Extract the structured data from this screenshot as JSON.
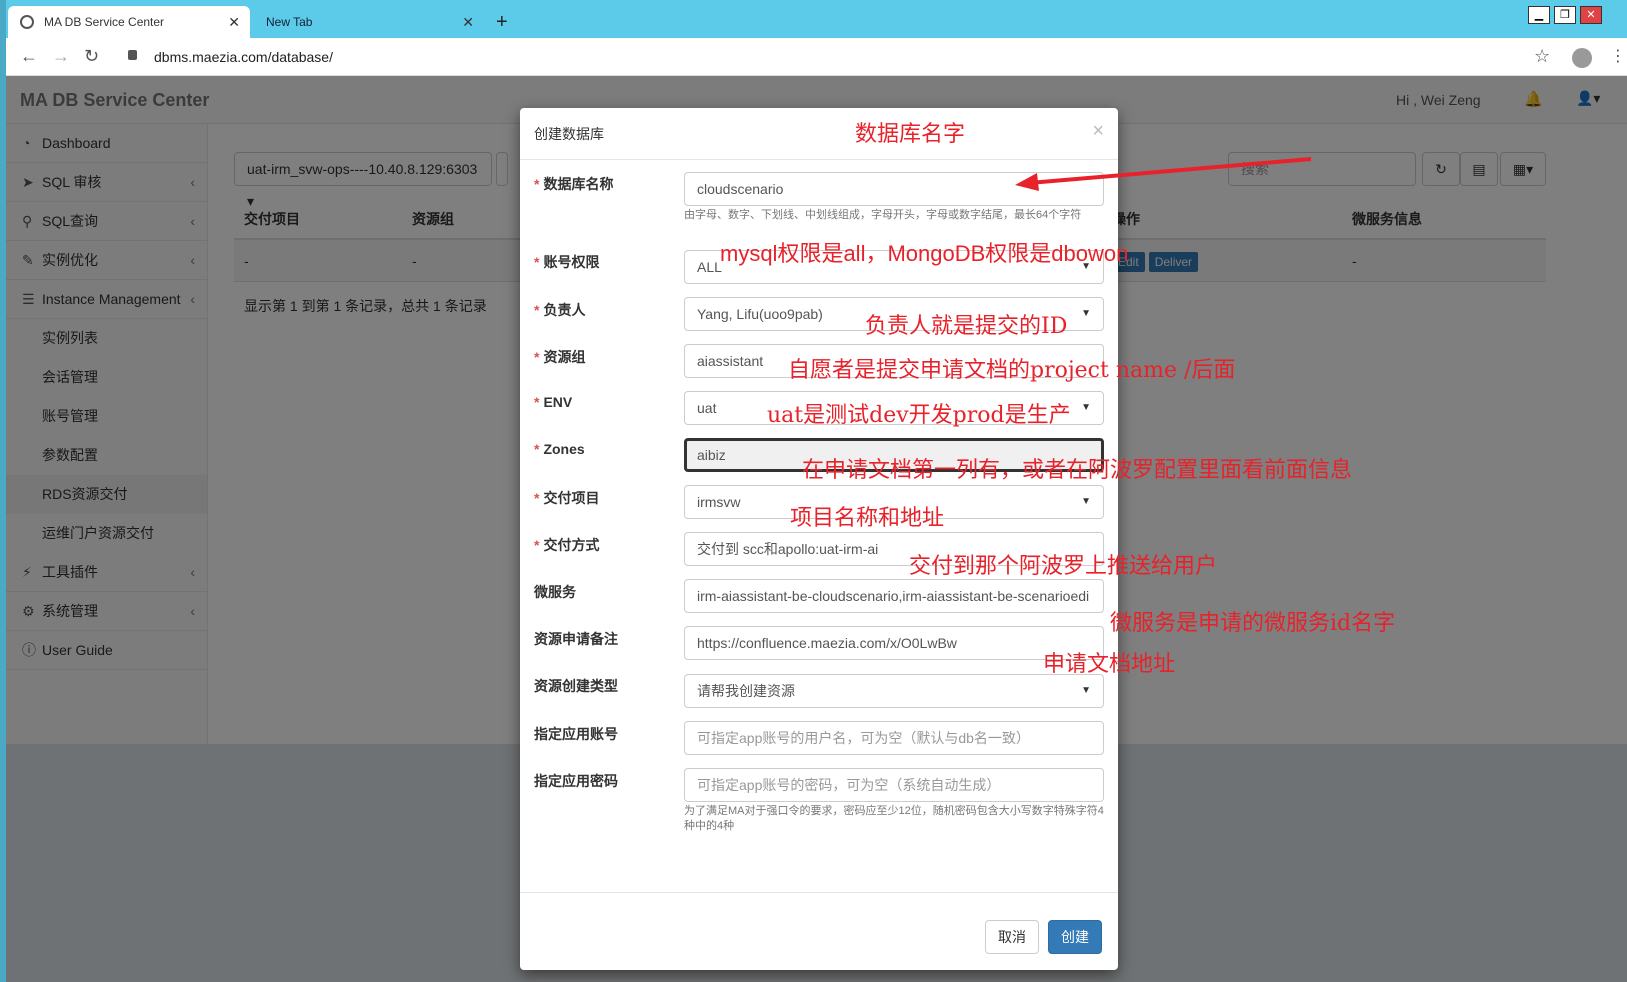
{
  "browser": {
    "tabs": [
      {
        "title": "MA DB Service Center",
        "active": true
      },
      {
        "title": "New Tab",
        "active": false
      }
    ],
    "new_tab_icon": "+",
    "url": "dbms.maezia.com/database/",
    "window_buttons": [
      "minimize",
      "restore",
      "close"
    ]
  },
  "header": {
    "brand": "MA DB Service Center",
    "greeting": "Hi , Wei Zeng"
  },
  "sidebar": {
    "items": [
      {
        "label": "Dashboard",
        "icon": "dashboard-icon"
      },
      {
        "label": "SQL 审核",
        "icon": "send-icon"
      },
      {
        "label": "SQL查询",
        "icon": "search-icon"
      },
      {
        "label": "实例优化",
        "icon": "wrench-icon"
      },
      {
        "label": "Instance Management",
        "icon": "database-icon"
      },
      {
        "label": "实例列表"
      },
      {
        "label": "会话管理"
      },
      {
        "label": "账号管理"
      },
      {
        "label": "参数配置"
      },
      {
        "label": "RDS资源交付"
      },
      {
        "label": "运维门户资源交付"
      },
      {
        "label": "工具插件",
        "icon": "plug-icon"
      },
      {
        "label": "系统管理",
        "icon": "gears-icon"
      },
      {
        "label": "User Guide",
        "icon": "info-icon"
      }
    ]
  },
  "content": {
    "instance_select": "uat-irm_svw-ops----10.40.8.129:6303",
    "search_placeholder": "搜索",
    "table": {
      "columns": [
        "交付项目",
        "资源组",
        "操作",
        "微服务信息"
      ],
      "row": [
        "-",
        "-",
        "",
        "-"
      ],
      "actions": [
        "Edit",
        "Deliver"
      ]
    },
    "summary": "显示第 1 到第 1 条记录，总共 1 条记录"
  },
  "modal": {
    "title": "创建数据库",
    "fields": [
      {
        "label": "数据库名称",
        "required": true,
        "value": "cloudscenario",
        "help": "由字母、数字、下划线、中划线组成，字母开头，字母或数字结尾，最长64个字符"
      },
      {
        "label": "账号权限",
        "required": true,
        "value": "ALL"
      },
      {
        "label": "负责人",
        "required": true,
        "value": "Yang, Lifu(uoo9pab)"
      },
      {
        "label": "资源组",
        "required": true,
        "value": "aiassistant"
      },
      {
        "label": "ENV",
        "required": true,
        "value": "uat"
      },
      {
        "label": "Zones",
        "required": true,
        "value": "aibiz"
      },
      {
        "label": "交付项目",
        "required": true,
        "value": "irmsvw"
      },
      {
        "label": "交付方式",
        "required": true,
        "value": "交付到 scc和apollo:uat-irm-ai"
      },
      {
        "label": "微服务",
        "required": false,
        "value": "irm-aiassistant-be-cloudscenario,irm-aiassistant-be-scenarioedi"
      },
      {
        "label": "资源申请备注",
        "required": false,
        "value": "https://confluence.maezia.com/x/O0LwBw"
      },
      {
        "label": "资源创建类型",
        "required": false,
        "value": "请帮我创建资源"
      },
      {
        "label": "指定应用账号",
        "required": false,
        "placeholder": "可指定app账号的用户名，可为空（默认与db名一致）"
      },
      {
        "label": "指定应用密码",
        "required": false,
        "placeholder": "可指定app账号的密码，可为空（系统自动生成）",
        "help": "为了满足MA对于强口令的要求，密码应至少12位，随机密码包含大小写数字特殊字符4种中的4种"
      }
    ],
    "buttons": {
      "cancel": "取消",
      "create": "创建"
    }
  },
  "annotations": [
    "数据库名字",
    "mysql权限是all，MongoDB权限是dbowon",
    "负责人就是提交的ID",
    "自愿者是提交申请文档的project name /后面",
    "uat是测试dev开发prod是生产",
    "在申请文档第一列有，或者在阿波罗配置里面看前面信息",
    "项目名称和地址",
    "交付到那个阿波罗上推送给用户",
    "微服务是申请的微服务id名字",
    "申请文档地址"
  ],
  "colors": {
    "accent": "#337ab7",
    "chrome": "#5ccbea",
    "annotation": "#e8222a"
  }
}
